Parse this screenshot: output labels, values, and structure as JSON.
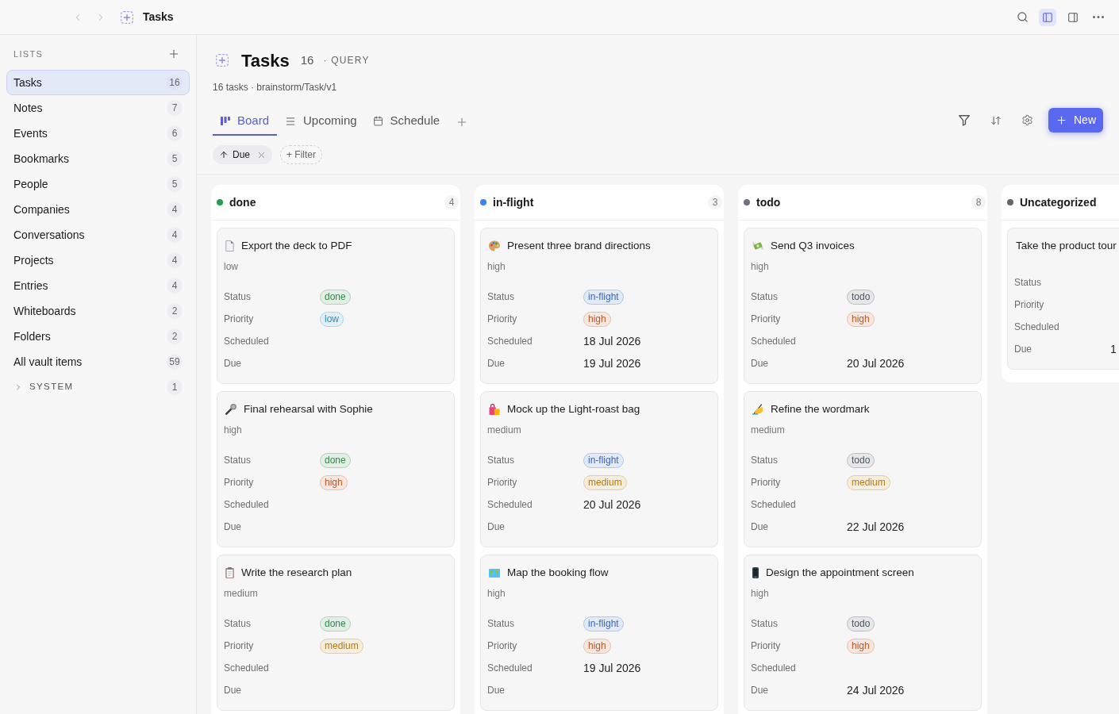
{
  "topbar": {
    "title": "Tasks",
    "panel_toggles": [
      {
        "kind": "left",
        "on": true
      },
      {
        "kind": "right",
        "on": false
      }
    ]
  },
  "sidebar": {
    "heading": "LISTS",
    "items": [
      {
        "label": "Tasks",
        "count": "16",
        "selected": true
      },
      {
        "label": "Notes",
        "count": "7",
        "selected": false
      },
      {
        "label": "Events",
        "count": "6",
        "selected": false
      },
      {
        "label": "Bookmarks",
        "count": "5",
        "selected": false
      },
      {
        "label": "People",
        "count": "5",
        "selected": false
      },
      {
        "label": "Companies",
        "count": "4",
        "selected": false
      },
      {
        "label": "Conversations",
        "count": "4",
        "selected": false
      },
      {
        "label": "Projects",
        "count": "4",
        "selected": false
      },
      {
        "label": "Entries",
        "count": "4",
        "selected": false
      },
      {
        "label": "Whiteboards",
        "count": "2",
        "selected": false
      },
      {
        "label": "Folders",
        "count": "2",
        "selected": false
      },
      {
        "label": "All vault items",
        "count": "59",
        "selected": false
      }
    ],
    "system": {
      "label": "SYSTEM",
      "count": "1",
      "expanded": false
    }
  },
  "header": {
    "title": "Tasks",
    "count": "16",
    "type_label": "· QUERY",
    "subtitle": "16 tasks · brainstorm/Task/v1"
  },
  "views": [
    {
      "kind": "board",
      "label": "Board",
      "selected": true
    },
    {
      "kind": "list",
      "label": "Upcoming",
      "selected": false
    },
    {
      "kind": "calendar",
      "label": "Schedule",
      "selected": false
    }
  ],
  "new_button": {
    "label": "New"
  },
  "filters": {
    "sort": {
      "label": "Due",
      "kind": "ascending"
    },
    "add_filter": "+ Filter"
  },
  "columns": [
    {
      "name": "done",
      "count": "4",
      "color": "#22a04b",
      "cards": [
        {
          "title": "Export the deck to PDF",
          "kind": "document",
          "subtitle": "low",
          "fields": [
            {
              "label": "Status",
              "kind": "chip",
              "value": "done",
              "color": "#2e8a48"
            },
            {
              "label": "Priority",
              "kind": "chip",
              "value": "low",
              "color": "#2a8fc4"
            },
            {
              "label": "Scheduled",
              "kind": "date"
            },
            {
              "label": "Due",
              "kind": "date"
            }
          ]
        },
        {
          "title": "Final rehearsal with Sophie",
          "kind": "microphone",
          "subtitle": "high",
          "fields": [
            {
              "label": "Status",
              "kind": "chip",
              "value": "done",
              "color": "#2e8a48"
            },
            {
              "label": "Priority",
              "kind": "chip",
              "value": "high",
              "color": "#c4571f"
            },
            {
              "label": "Scheduled",
              "kind": "date"
            },
            {
              "label": "Due",
              "kind": "date"
            }
          ]
        },
        {
          "title": "Write the research plan",
          "kind": "clipboard",
          "subtitle": "medium",
          "fields": [
            {
              "label": "Status",
              "kind": "chip",
              "value": "done",
              "color": "#2e8a48"
            },
            {
              "label": "Priority",
              "kind": "chip",
              "value": "medium",
              "color": "#b57b12"
            },
            {
              "label": "Scheduled",
              "kind": "date"
            },
            {
              "label": "Due",
              "kind": "date"
            }
          ]
        }
      ]
    },
    {
      "name": "in-flight",
      "count": "3",
      "color": "#3b82f6",
      "cards": [
        {
          "title": "Present three brand directions",
          "kind": "palette",
          "subtitle": "high",
          "fields": [
            {
              "label": "Status",
              "kind": "chip",
              "value": "in-flight",
              "color": "#3567c9"
            },
            {
              "label": "Priority",
              "kind": "chip",
              "value": "high",
              "color": "#c4571f"
            },
            {
              "label": "Scheduled",
              "kind": "date",
              "value": "18 Jul 2026"
            },
            {
              "label": "Due",
              "kind": "date",
              "value": "19 Jul 2026"
            }
          ]
        },
        {
          "title": "Mock up the Light-roast bag",
          "kind": "bags",
          "subtitle": "medium",
          "fields": [
            {
              "label": "Status",
              "kind": "chip",
              "value": "in-flight",
              "color": "#3567c9"
            },
            {
              "label": "Priority",
              "kind": "chip",
              "value": "medium",
              "color": "#b57b12"
            },
            {
              "label": "Scheduled",
              "kind": "date",
              "value": "20 Jul 2026"
            },
            {
              "label": "Due",
              "kind": "date"
            }
          ]
        },
        {
          "title": "Map the booking flow",
          "kind": "map",
          "subtitle": "high",
          "fields": [
            {
              "label": "Status",
              "kind": "chip",
              "value": "in-flight",
              "color": "#3567c9"
            },
            {
              "label": "Priority",
              "kind": "chip",
              "value": "high",
              "color": "#c4571f"
            },
            {
              "label": "Scheduled",
              "kind": "date",
              "value": "19 Jul 2026"
            },
            {
              "label": "Due",
              "kind": "date"
            }
          ]
        }
      ]
    },
    {
      "name": "todo",
      "count": "8",
      "color": "#6b7280",
      "cards": [
        {
          "title": "Send Q3 invoices",
          "kind": "money",
          "subtitle": "high",
          "fields": [
            {
              "label": "Status",
              "kind": "chip",
              "value": "todo",
              "color": "#4b5563"
            },
            {
              "label": "Priority",
              "kind": "chip",
              "value": "high",
              "color": "#c4571f"
            },
            {
              "label": "Scheduled",
              "kind": "date"
            },
            {
              "label": "Due",
              "kind": "date",
              "value": "20 Jul 2026"
            }
          ]
        },
        {
          "title": "Refine the wordmark",
          "kind": "writing",
          "subtitle": "medium",
          "fields": [
            {
              "label": "Status",
              "kind": "chip",
              "value": "todo",
              "color": "#4b5563"
            },
            {
              "label": "Priority",
              "kind": "chip",
              "value": "medium",
              "color": "#b57b12"
            },
            {
              "label": "Scheduled",
              "kind": "date"
            },
            {
              "label": "Due",
              "kind": "date",
              "value": "22 Jul 2026"
            }
          ]
        },
        {
          "title": "Design the appointment screen",
          "kind": "phone",
          "subtitle": "high",
          "fields": [
            {
              "label": "Status",
              "kind": "chip",
              "value": "todo",
              "color": "#4b5563"
            },
            {
              "label": "Priority",
              "kind": "chip",
              "value": "high",
              "color": "#c4571f"
            },
            {
              "label": "Scheduled",
              "kind": "date"
            },
            {
              "label": "Due",
              "kind": "date",
              "value": "24 Jul 2026"
            }
          ]
        }
      ]
    },
    {
      "name": "Uncategorized",
      "color": "#666666",
      "cards": [
        {
          "title": "Take the product tour",
          "kind": "plain",
          "fields": [
            {
              "label": "Status",
              "kind": "chip"
            },
            {
              "label": "Priority",
              "kind": "chip"
            },
            {
              "label": "Scheduled",
              "kind": "date"
            },
            {
              "label": "Due",
              "kind": "date",
              "value": "1"
            }
          ]
        }
      ]
    }
  ]
}
